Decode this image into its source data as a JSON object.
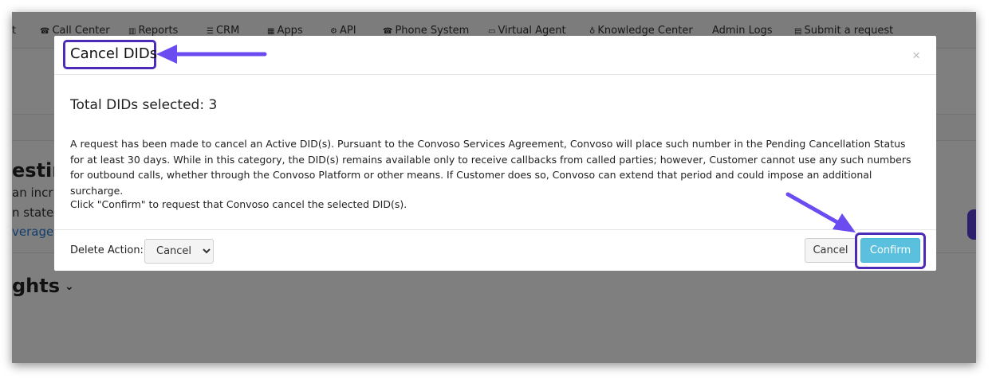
{
  "nav": {
    "items": [
      {
        "label": "t",
        "icon": ""
      },
      {
        "label": "Call Center",
        "icon": "phone-icon"
      },
      {
        "label": "Reports",
        "icon": "bar-chart-icon"
      },
      {
        "label": "CRM",
        "icon": "list-icon"
      },
      {
        "label": "Apps",
        "icon": "grid-icon"
      },
      {
        "label": "API",
        "icon": "gear-icon"
      },
      {
        "label": "Phone System",
        "icon": "phone-icon"
      },
      {
        "label": "Virtual Agent",
        "icon": "monitor-icon"
      },
      {
        "label": "Knowledge Center",
        "icon": "lightbulb-icon"
      },
      {
        "label": "Admin Logs",
        "icon": ""
      },
      {
        "label": "Submit a request",
        "icon": "ticket-icon"
      }
    ]
  },
  "background": {
    "heading": "estin",
    "line1": "an incr",
    "line2": "n states",
    "link": "verage",
    "insights": "ghts"
  },
  "modal": {
    "title": "Cancel DIDs",
    "close": "×",
    "total": "Total DIDs selected: 3",
    "notice": "A request has been made to cancel an Active DID(s). Pursuant to the Convoso Services Agreement, Convoso will place such number in the Pending Cancellation Status for at least 30 days. While in this category, the DID(s) remains available only to receive callbacks from called parties; however, Customer cannot use any such numbers for outbound calls, whether through the Convoso Platform or other means. If Customer does so, Convoso can extend that period and could impose an additional surcharge.",
    "instruction": "Click \"Confirm\" to request that Convoso cancel the selected DID(s).",
    "delete_action_label": "Delete Action:",
    "delete_action_value": "Cancel",
    "cancel_label": "Cancel",
    "confirm_label": "Confirm"
  },
  "colors": {
    "annotation": "#6b4cf0",
    "annotation_border": "#4b2bb8",
    "confirm": "#5bc0de"
  }
}
